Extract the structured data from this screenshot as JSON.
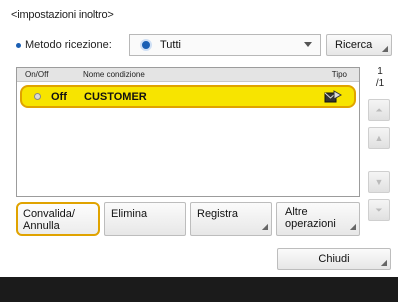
{
  "title": "<impostazioni inoltro>",
  "method": {
    "label": "Metodo ricezione:",
    "selected": "Tutti",
    "search_button": "Ricerca"
  },
  "list": {
    "headers": {
      "onoff": "On/Off",
      "name": "Nome condizione",
      "type": "Tipo"
    },
    "rows": [
      {
        "onoff": "Off",
        "name": "CUSTOMER",
        "type_icon": "forward-mail-icon"
      }
    ]
  },
  "pager": {
    "current": "1",
    "total": "/1"
  },
  "actions": {
    "convalida_line1": "Convalida/",
    "convalida_line2": "Annulla",
    "elimina": "Elimina",
    "registra": "Registra",
    "altre_line1": "Altre",
    "altre_line2": "operazioni",
    "chiudi": "Chiudi"
  },
  "colors": {
    "selected_row": "#f7e400",
    "selected_border": "#e0a300",
    "accent_dot": "#1a5fb4",
    "footer": "#1b1b1b"
  }
}
